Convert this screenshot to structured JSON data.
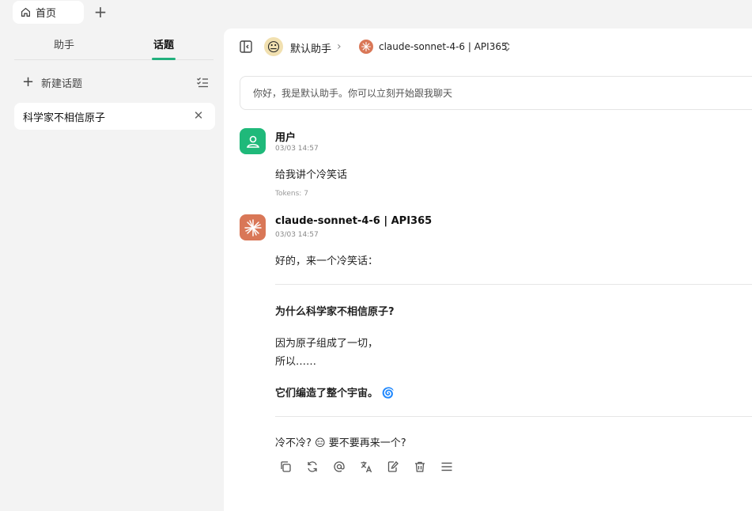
{
  "tabbar": {
    "home_tab": "首页",
    "add_label": "+"
  },
  "sidebar": {
    "tabs": [
      {
        "label": "助手",
        "active": false
      },
      {
        "label": "话题",
        "active": true
      }
    ],
    "new_topic_label": "新建话题",
    "topics": [
      {
        "label": "科学家不相信原子",
        "close": "✕"
      }
    ]
  },
  "header": {
    "assistant_avatar": "😐",
    "assistant_name": "默认助手",
    "separator": "›",
    "model_name": "claude-sonnet-4-6 | API365"
  },
  "greeting": "你好，我是默认助手。你可以立刻开始跟我聊天",
  "messages": {
    "user": {
      "name": "用户",
      "time": "03/03 14:57",
      "text": "给我讲个冷笑话",
      "tokens": "Tokens: 7"
    },
    "bot": {
      "name": "claude-sonnet-4-6 | API365",
      "time": "03/03 14:57",
      "intro": "好的，来一个冷笑话：",
      "question": "为什么科学家不相信原子?",
      "line1": "因为原子组成了一切，",
      "line2": "所以……",
      "punchline": "它们编造了整个宇宙。",
      "punchline_emoji": "🌀",
      "closing_a": "冷不冷?",
      "closing_emoji": "😑",
      "closing_b": "要不要再来一个?"
    }
  },
  "colors": {
    "accent": "#22b07d",
    "user_avatar": "#1fb97a",
    "bot_avatar": "#d97757"
  }
}
